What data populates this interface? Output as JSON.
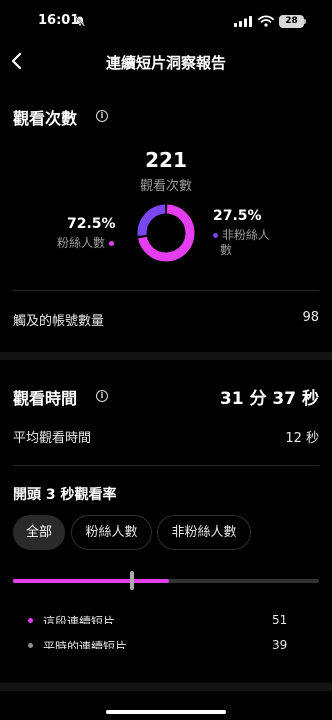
{
  "status_bar": {
    "time": "16:01",
    "battery": "28"
  },
  "header": {
    "title": "連續短片洞察報告"
  },
  "views": {
    "title": "觀看次數",
    "total": "221",
    "total_label": "觀看次數",
    "followers_pct": "72.5%",
    "followers_label": "粉絲人數",
    "non_followers_pct": "27.5%",
    "non_followers_label_line1": "非粉絲人",
    "non_followers_label_line2": "數",
    "followers_fraction": 0.725,
    "reach_label": "觸及的帳號數量",
    "reach_value": "98"
  },
  "watch_time": {
    "title": "觀看時間",
    "total": "31 分 37 秒",
    "avg_label": "平均觀看時間",
    "avg_value": "12 秒"
  },
  "retention": {
    "title": "開頭 3 秒觀看率",
    "filters": [
      {
        "label": "全部",
        "active": true
      },
      {
        "label": "粉絲人數",
        "active": false
      },
      {
        "label": "非粉絲人數",
        "active": false
      }
    ],
    "this_reel_fraction": 0.51,
    "typical_fraction": 0.39,
    "legend": [
      {
        "label": "這段連續短片",
        "value": "51",
        "color": "#e43ef0"
      },
      {
        "label": "平時的連續短片",
        "value": "39",
        "color": "#8e8e8e"
      }
    ]
  },
  "colors": {
    "followers": "#e43ef0",
    "non_followers": "#7b47f0",
    "track": "#333333"
  }
}
